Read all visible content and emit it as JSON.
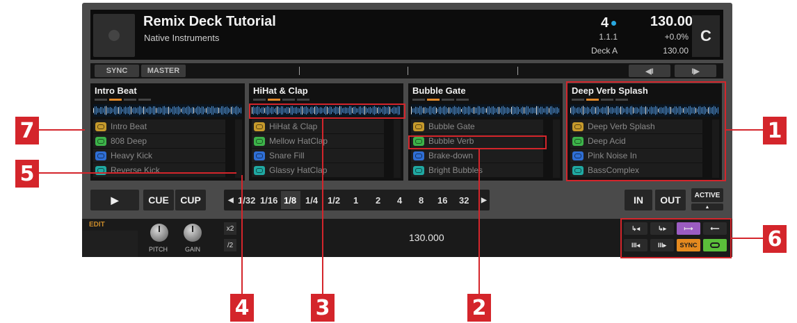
{
  "track": {
    "title": "Remix Deck Tutorial",
    "artist": "Native Instruments",
    "beats": "4",
    "position": "1.1.1",
    "deck": "Deck A",
    "bpm": "130.00",
    "tempo_offset": "+0.0%",
    "bpm_small": "130.00",
    "deck_letter": "C"
  },
  "strip": {
    "sync": "SYNC",
    "master": "MASTER",
    "left_arrow": "◀I",
    "right_arrow": "I▶"
  },
  "slots": [
    {
      "name": "Intro Beat",
      "cells": [
        {
          "label": "Intro Beat",
          "color": "#c69a2c"
        },
        {
          "label": "808 Deep",
          "color": "#3db34a"
        },
        {
          "label": "Heavy Kick",
          "color": "#2f6fd6"
        },
        {
          "label": "Reverse Kick",
          "color": "#20a9a3"
        }
      ]
    },
    {
      "name": "HiHat & Clap",
      "cells": [
        {
          "label": "HiHat & Clap",
          "color": "#c69a2c"
        },
        {
          "label": "Mellow HatClap",
          "color": "#3db34a"
        },
        {
          "label": "Snare Fill",
          "color": "#2f6fd6"
        },
        {
          "label": "Glassy HatClap",
          "color": "#20a9a3"
        }
      ]
    },
    {
      "name": "Bubble Gate",
      "cells": [
        {
          "label": "Bubble Gate",
          "color": "#c69a2c"
        },
        {
          "label": "Bubble Verb",
          "color": "#3db34a"
        },
        {
          "label": "Brake-down",
          "color": "#2f6fd6"
        },
        {
          "label": "Bright Bubbles",
          "color": "#20a9a3"
        }
      ]
    },
    {
      "name": "Deep Verb Splash",
      "cells": [
        {
          "label": "Deep Verb Splash",
          "color": "#c69a2c"
        },
        {
          "label": "Deep Acid",
          "color": "#3db34a"
        },
        {
          "label": "Pink Noise In",
          "color": "#2f6fd6"
        },
        {
          "label": "BassComplex",
          "color": "#20a9a3"
        }
      ]
    }
  ],
  "transport": {
    "play": "▶",
    "cue": "CUE",
    "cup": "CUP",
    "in": "IN",
    "out": "OUT",
    "active": "ACTIVE"
  },
  "rates": [
    "1/32",
    "1/16",
    "1/8",
    "1/4",
    "1/2",
    "1",
    "2",
    "4",
    "8",
    "16",
    "32"
  ],
  "selected_rate": "1/8",
  "edit_panel": {
    "edit": "EDIT",
    "pitch": "PITCH",
    "gain": "GAIN",
    "x2": "x2",
    "half": "/2",
    "tempo": "130.000"
  },
  "pads": {
    "sync": "SYNC"
  },
  "callouts": [
    "1",
    "2",
    "3",
    "4",
    "5",
    "6",
    "7"
  ]
}
